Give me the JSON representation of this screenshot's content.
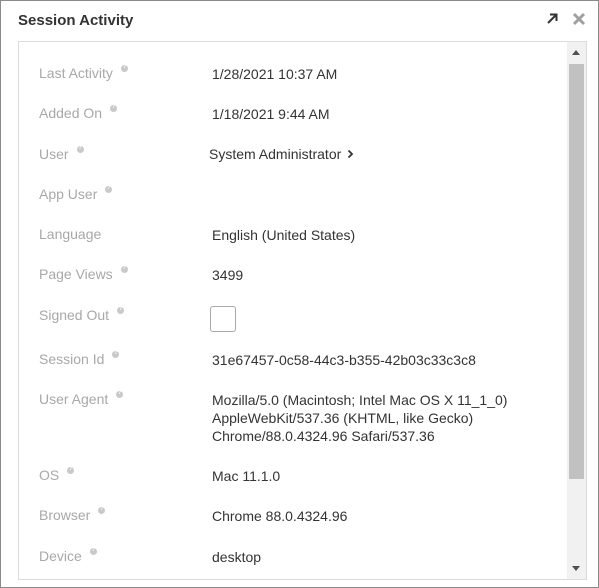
{
  "window": {
    "title": "Session Activity",
    "expand_icon": "arrow-up-right-icon",
    "close_icon": "close-icon"
  },
  "fields": {
    "last_activity": {
      "label": "Last Activity",
      "value": "1/28/2021 10:37 AM"
    },
    "added_on": {
      "label": "Added On",
      "value": "1/18/2021 9:44 AM"
    },
    "user": {
      "label": "User",
      "value": "System Administrator"
    },
    "app_user": {
      "label": "App User",
      "value": ""
    },
    "language": {
      "label": "Language",
      "value": "English (United States)"
    },
    "page_views": {
      "label": "Page Views",
      "value": "3499"
    },
    "signed_out": {
      "label": "Signed Out",
      "checked": false
    },
    "session_id": {
      "label": "Session Id",
      "value": "31e67457-0c58-44c3-b355-42b03c33c3c8"
    },
    "user_agent": {
      "label": "User Agent",
      "lines": [
        "Mozilla/5.0 (Macintosh; Intel Mac OS X 11_1_0)",
        "AppleWebKit/537.36 (KHTML, like Gecko)",
        "Chrome/88.0.4324.96 Safari/537.36"
      ]
    },
    "os": {
      "label": "OS",
      "value": "Mac 11.1.0"
    },
    "browser": {
      "label": "Browser",
      "value": "Chrome 88.0.4324.96"
    },
    "device": {
      "label": "Device",
      "value": "desktop"
    }
  },
  "colors": {
    "label": "#a8a8a8",
    "value": "#333333",
    "border": "#8a8a8a",
    "help_icon": "#c9c9c9"
  }
}
